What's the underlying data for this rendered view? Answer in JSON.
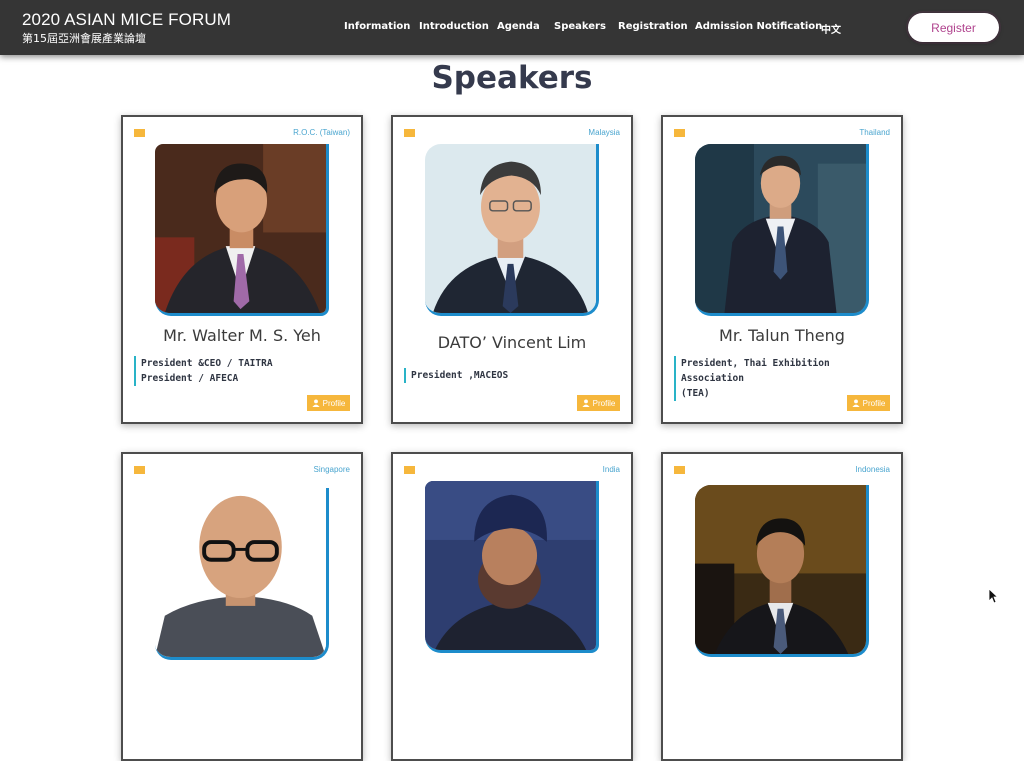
{
  "header": {
    "title": "2020 ASIAN MICE FORUM",
    "subtitle": "第15屆亞洲會展產業論壇",
    "nav": [
      {
        "label": "Information"
      },
      {
        "label": "Introduction"
      },
      {
        "label": "Agenda"
      },
      {
        "label": "Speakers"
      },
      {
        "label": "Registration"
      },
      {
        "label": "Admission Notification"
      },
      {
        "label": "中文"
      }
    ],
    "register_label": "Register"
  },
  "page": {
    "title": "Speakers"
  },
  "speakers": [
    {
      "country": "R.O.C. (Taiwan)",
      "name": "Mr. Walter M. S. Yeh",
      "titles": [
        "President &CEO / TAITRA",
        "President / AFECA"
      ],
      "profile_label": "Profile"
    },
    {
      "country": "Malaysia",
      "name": "DATO’ Vincent Lim",
      "titles": [
        "President ,MACEOS"
      ],
      "profile_label": "Profile"
    },
    {
      "country": "Thailand",
      "name": "Mr. Talun Theng",
      "titles": [
        "President, Thai Exhibition Association",
        "(TEA)"
      ],
      "profile_label": "Profile"
    },
    {
      "country": "Singapore"
    },
    {
      "country": "India"
    },
    {
      "country": "Indonesia"
    }
  ],
  "colors": {
    "header_bg": "#353535",
    "accent_yellow": "#f6b73c",
    "accent_blue": "#1d8ccb",
    "accent_teal": "#29b3c7",
    "register_text": "#b0448e"
  },
  "icons": {
    "profile": "user-icon",
    "flag": "flag-icon",
    "cursor": "mouse-pointer-icon"
  }
}
